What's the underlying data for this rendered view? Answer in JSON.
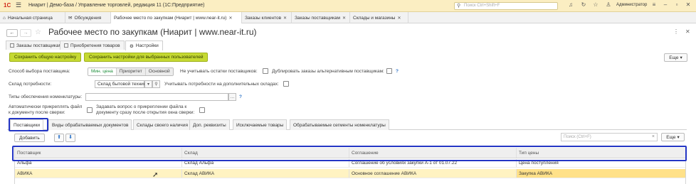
{
  "titlebar": {
    "logo": "1С",
    "title": "Ниарит | Демо-база / Управление торговлей, редакция 11  (1С:Предприятие)",
    "search_placeholder": "Поиск Ctrl+Shift+F",
    "user": "Администратор"
  },
  "window_tabs": [
    {
      "label": "Начальная страница",
      "icon": "home-icon"
    },
    {
      "label": "Обсуждения",
      "icon": "chat-icon"
    },
    {
      "label": "Рабочее место по закупкам (Ниарит | www.near-it.ru)",
      "active": true
    },
    {
      "label": "Заказы клиентов"
    },
    {
      "label": "Заказы поставщикам"
    },
    {
      "label": "Склады и магазины"
    }
  ],
  "header": {
    "title": "Рабочее место по закупкам (Ниарит | www.near-it.ru)"
  },
  "form_tabs": [
    {
      "label": "Заказы поставщикам"
    },
    {
      "label": "Приобретения товаров"
    },
    {
      "label": "Настройки",
      "active": true
    }
  ],
  "buttons": {
    "save_common": "Сохранить общую настройку",
    "save_selected": "Сохранить настройки для выбранных пользователей",
    "more": "Еще",
    "add": "Добавить"
  },
  "settings": {
    "supplier_method_label": "Способ выбора поставщика:",
    "supplier_method_options": [
      "Мин. цена",
      "Приоритет",
      "Основной"
    ],
    "ignore_stock_label": "Не учитывать остатки поставщиков:",
    "duplicate_orders_label": "Дублировать заказы альтернативным поставщикам:",
    "need_warehouse_label": "Склад потребности:",
    "need_warehouse_value": "Склад бытовой техники",
    "consider_extra_label": "Учитывать потребности на дополнительных складах:",
    "supply_types_label": "Типы обеспечения номенклатуры:",
    "supply_types_value": "",
    "auto_attach_label_1": "Автоматически прикреплять файл",
    "auto_attach_label_2": "к документу после сверки:",
    "ask_attach_label_1": "Задавать вопрос о прикреплении файла к",
    "ask_attach_label_2": "документу сразу после открытия окна сверки:"
  },
  "inner_tabs": [
    {
      "label": "Поставщики",
      "active": true
    },
    {
      "label": "Виды обрабатываемых документов"
    },
    {
      "label": "Склады своего наличия"
    },
    {
      "label": "Доп. реквизиты"
    },
    {
      "label": "Исключаемые товары"
    },
    {
      "label": "Обрабатываемые сегменты номенклатуры"
    }
  ],
  "table": {
    "search_placeholder": "Поиск (Ctrl+F)",
    "columns": [
      "Поставщик",
      "Склад",
      "Соглашение",
      "Тип цены"
    ],
    "rows": [
      [
        "Альфа",
        "Склад Альфа",
        "Соглашение об условиях закупки А-1 от 01.07.22",
        "Цена поступления"
      ],
      [
        "АВИКА",
        "Склад АВИКА",
        "Основное соглашение АВИКА",
        "Закупка АВИКА"
      ]
    ]
  }
}
